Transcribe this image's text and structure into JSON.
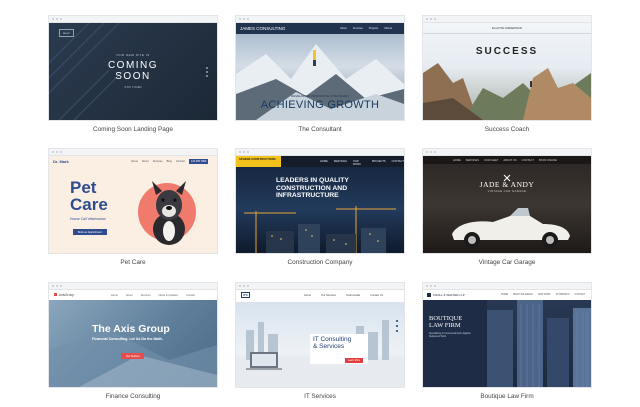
{
  "templates": [
    {
      "caption": "Coming Soon Landing Page",
      "content": {
        "kicker": "OUR NEW SITE IS",
        "title_line1": "COMING",
        "title_line2": "SOON",
        "sub": "STAY TUNED",
        "logo": "Heyz"
      }
    },
    {
      "caption": "The Consultant",
      "content": {
        "brand": "JAMES CONSULTING",
        "nav": [
          "About",
          "Services",
          "Projects",
          "Clients"
        ],
        "tagline": "DEVELOPING INNOVATIVE STRATEGIES",
        "headline": "ACHIEVING GROWTH"
      }
    },
    {
      "caption": "Success Coach",
      "content": {
        "brand": "ELLIOTE ANDERSON",
        "title": "SUCCESS"
      }
    },
    {
      "caption": "Pet Care",
      "content": {
        "brand": "Dr. Mark",
        "nav": [
          "Home",
          "About",
          "Services",
          "Blog",
          "Contact"
        ],
        "cta": "123.456.7890",
        "title_line1": "Pet",
        "title_line2": "Care",
        "sub": "House Call Veterinarian",
        "button": "Book an Appointment"
      }
    },
    {
      "caption": "Construction Company",
      "content": {
        "brand": "SPHERE CONSTRUCTIONS",
        "nav": [
          "HOME",
          "SERVICES",
          "OUR WORK",
          "PROJECTS",
          "CONTACT"
        ],
        "headline": "LEADERS IN QUALITY CONSTRUCTION AND INFRASTRUCTURE"
      }
    },
    {
      "caption": "Vintage Car Garage",
      "content": {
        "nav": [
          "HOME",
          "SERVICES",
          "OUR FLEET",
          "ABOUT US",
          "CONTACT",
          "BOOK ONLINE"
        ],
        "title": "JADE & ANDY",
        "sub": "VINTAGE CAR GARAGE"
      }
    },
    {
      "caption": "Finance Consulting",
      "content": {
        "brand": "AxisGroup",
        "nav": [
          "Home",
          "About",
          "Services",
          "News & Updates",
          "Contact"
        ],
        "title": "The Axis Group",
        "sub": "Financial Consulting. Let Us Do the Math.",
        "button": "Get Started"
      }
    },
    {
      "caption": "IT Services",
      "content": {
        "logo": "ITS",
        "nav": [
          "Home",
          "Our Services",
          "Testimonials",
          "Contact Us"
        ],
        "title_line1": "IT Consulting",
        "title_line2": "& Services",
        "button": "Learn More"
      }
    },
    {
      "caption": "Boutique Law Firm",
      "content": {
        "brand": "KNOLL & WALTER LLP",
        "nav": [
          "HOME",
          "PRACTICE AREAS",
          "OUR WORK",
          "ATTORNEYS",
          "CONTACT"
        ],
        "title_line1": "BOUTIQUE",
        "title_line2": "LAW FIRM",
        "sub": "Specializing in Commercial and Litigation Settlement Work"
      }
    }
  ]
}
